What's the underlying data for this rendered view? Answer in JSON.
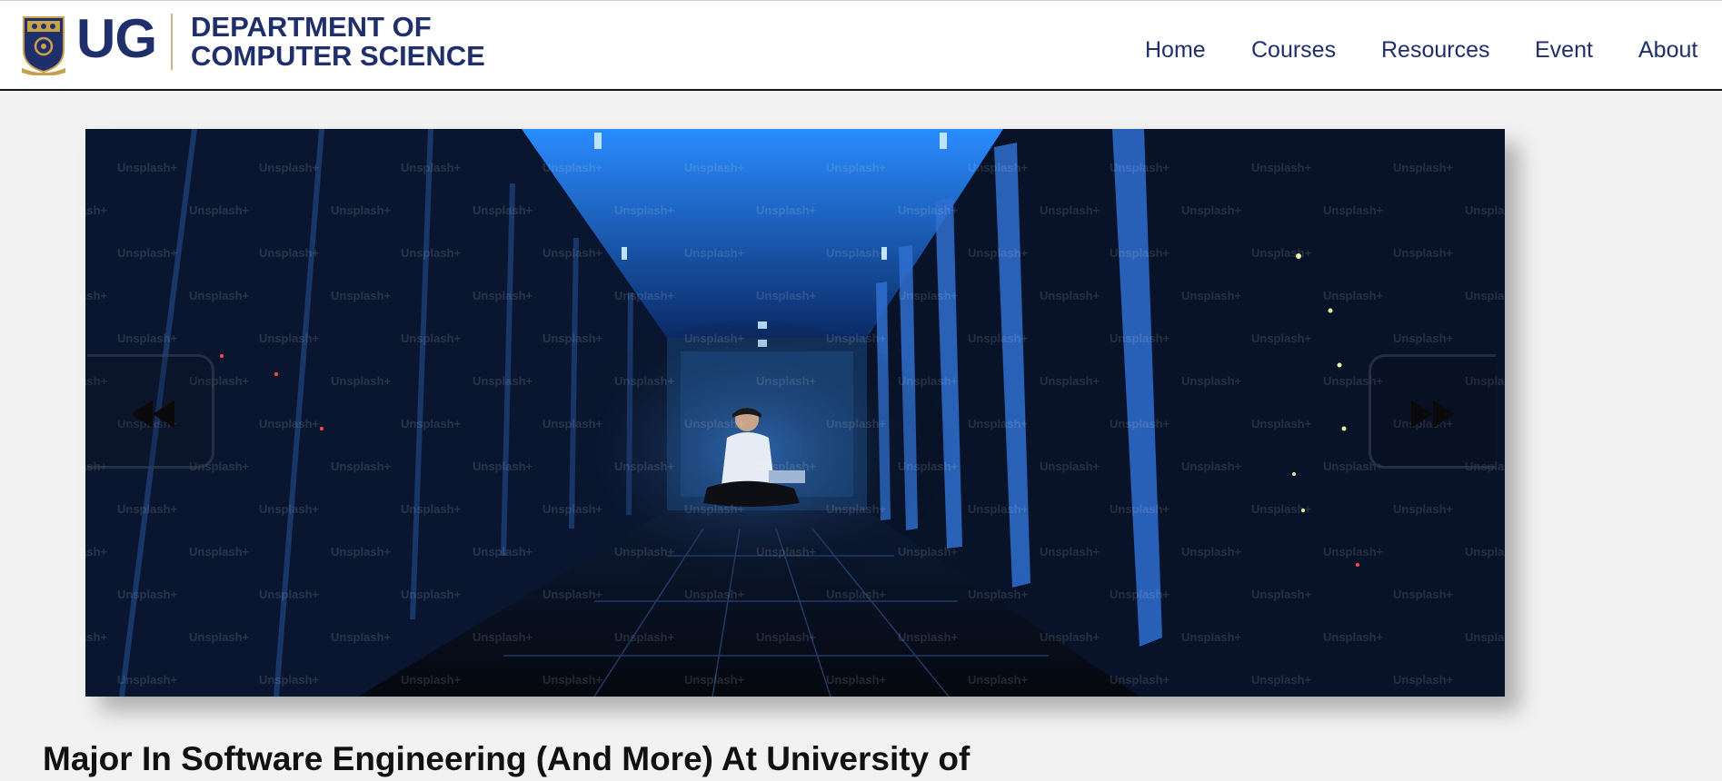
{
  "header": {
    "logo_text": "UG",
    "department_line1": "DEPARTMENT OF",
    "department_line2": "COMPUTER SCIENCE",
    "crest_icon": "university-crest-icon"
  },
  "nav": {
    "items": [
      "Home",
      "Courses",
      "Resources",
      "Event",
      "About"
    ]
  },
  "slider": {
    "image_description_icon": "data-center-photo",
    "watermark": "Unsplash+",
    "prev_icon": "double-chevron-left-icon",
    "next_icon": "double-chevron-right-icon"
  },
  "article": {
    "headline": "Major In Software Engineering (And More) At University of"
  },
  "colors": {
    "brand_navy": "#1f2f6b",
    "crest_gold": "#c8a24a",
    "page_bg": "#f2f2f2"
  }
}
